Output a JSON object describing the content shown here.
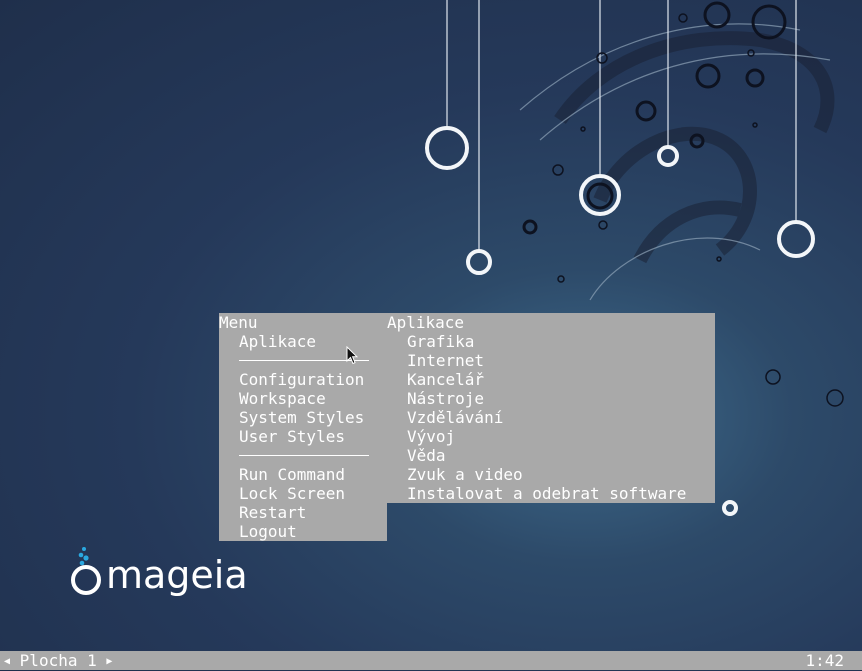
{
  "main_menu": {
    "title": "Menu",
    "items": [
      {
        "label": "Aplikace"
      },
      {
        "separator": true
      },
      {
        "label": "Configuration"
      },
      {
        "label": "Workspace"
      },
      {
        "label": "System Styles"
      },
      {
        "label": "User Styles"
      },
      {
        "separator": true
      },
      {
        "label": "Run Command"
      },
      {
        "label": "Lock Screen"
      },
      {
        "label": "Restart"
      },
      {
        "label": "Logout"
      }
    ]
  },
  "apps_menu": {
    "title": "Aplikace",
    "items": [
      {
        "label": "Grafika"
      },
      {
        "label": "Internet"
      },
      {
        "label": "Kancelář"
      },
      {
        "label": "Nástroje"
      },
      {
        "label": "Vzdělávání"
      },
      {
        "label": "Vývoj"
      },
      {
        "label": "Věda"
      },
      {
        "label": "Zvuk a video"
      },
      {
        "label": "Instalovat a odebrat software"
      }
    ]
  },
  "taskbar": {
    "workspace_name": "Plocha 1",
    "clock": "1:42"
  },
  "logo": {
    "text": "mageia"
  },
  "colors": {
    "menu_bg": "#a9a9a9",
    "menu_fg": "#ffffff",
    "desktop_bg": "#25395a",
    "logo_accent": "#2aa8e0"
  },
  "icons": [
    "mouse-cursor-icon",
    "left-arrow-icon",
    "right-arrow-icon",
    "mageia-logo-icon"
  ]
}
